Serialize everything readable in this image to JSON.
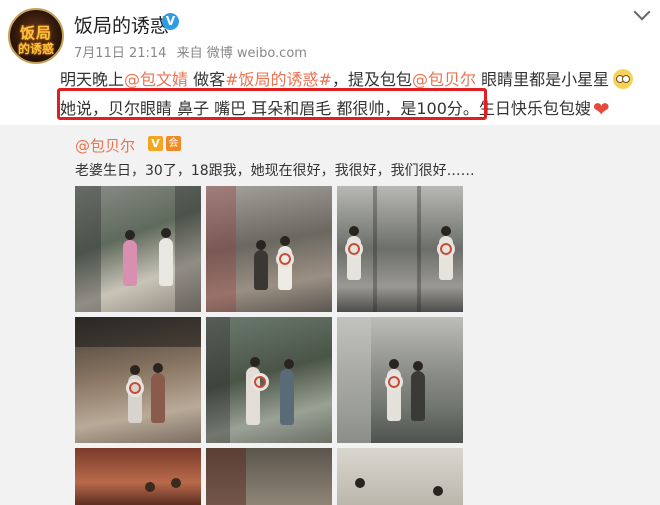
{
  "post": {
    "username": "饭局的诱惑",
    "verified_badge": "V",
    "date": "7月11日 21:14",
    "source": "来自 微博 weibo.com",
    "avatar_text_top": "饭局",
    "avatar_text_bottom": "的诱惑",
    "line1": {
      "p1": "明天晚上",
      "mention1": "@包文婧",
      "p2": " 做客",
      "tag": "#饭局的诱惑#",
      "p3": "，提及包包",
      "mention2": "@包贝尔",
      "p4": " 眼睛里都是小星星"
    },
    "line2": {
      "highlighted": "她说，贝尔眼睛 鼻子 嘴巴 耳朵和眉毛 都很帅，是100分。",
      "rest": "生日快乐包包嫂"
    },
    "icons": [
      "chevron-down-icon",
      "verified-icon",
      "star-eyes-emoji-icon",
      "heart-icon"
    ]
  },
  "repost": {
    "username": "@包贝尔",
    "badge_v": "V",
    "badge_member": "会",
    "text": "老婆生日，30了，18跟我，她现在很好，我很好，我们很好……",
    "photo_count": 9
  },
  "colors": {
    "link": "#eb7350",
    "highlight_border": "#e02020",
    "verified": "#2f9de3",
    "repost_bg": "#f2f2f2"
  }
}
